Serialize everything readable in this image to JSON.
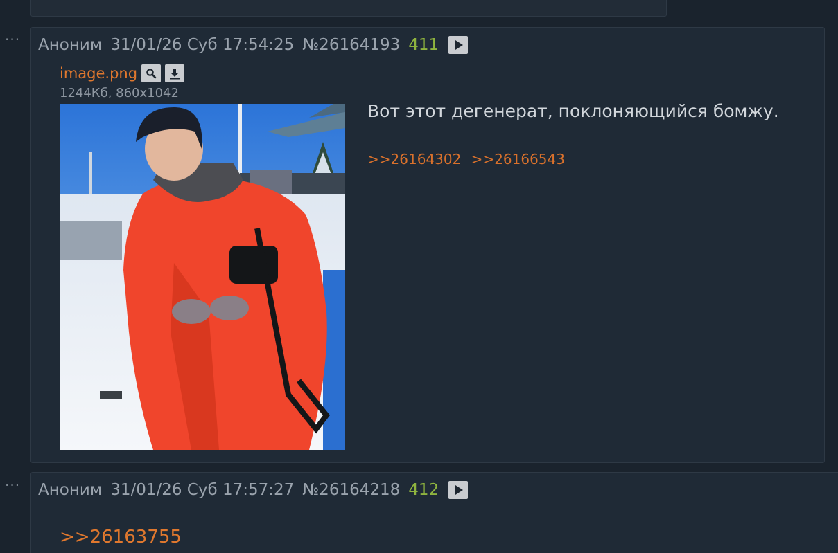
{
  "posts": [
    {
      "author": "Аноним",
      "date": "31/01/26 Суб 17:54:25",
      "number": "№26164193",
      "count": "411",
      "file": {
        "name": "image.png",
        "meta": "1244Кб, 860x1042"
      },
      "text": "Вот этот дегенерат, поклоняющийся бомжу.",
      "replies": [
        ">>26164302",
        ">>26166543"
      ]
    },
    {
      "author": "Аноним",
      "date": "31/01/26 Суб 17:57:27",
      "number": "№26164218",
      "count": "412",
      "quote": ">>26163755"
    }
  ],
  "icons": {
    "menu": "ellipsis-icon",
    "play": "play-icon",
    "search": "search-icon",
    "download": "download-icon"
  },
  "colors": {
    "background": "#1a232d",
    "post_bg": "#1f2a36",
    "link": "#e0782e",
    "count": "#8fb43f",
    "text": "#d2d7dc"
  }
}
